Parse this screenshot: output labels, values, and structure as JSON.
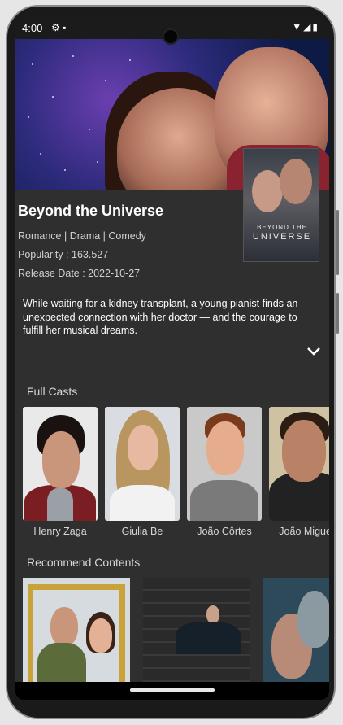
{
  "status_bar": {
    "time": "4:00",
    "sys_icons": "⚙ ▪",
    "right_icons": "▼◢▮"
  },
  "movie": {
    "title": "Beyond the Universe",
    "genres": "Romance | Drama | Comedy",
    "popularity": "Popularity : 163.527",
    "release_date": "Release Date : 2022-10-27",
    "overview": "While waiting for a kidney transplant, a young pianist finds an unexpected connection with her doctor — and the courage to fulfill her musical dreams.",
    "poster_text_top": "BEYOND THE",
    "poster_text_bottom": "UNIVERSE"
  },
  "cast_section": {
    "title": "Full Casts",
    "members": [
      {
        "name": "Henry Zaga"
      },
      {
        "name": "Giulia Be"
      },
      {
        "name": "João Côrtes"
      },
      {
        "name": "João Miguel"
      }
    ]
  },
  "recommend_section": {
    "title": "Recommend Contents"
  },
  "colors": {
    "background": "#2f2f2f",
    "text": "#ffffff",
    "muted_text": "#d6d6d6"
  }
}
